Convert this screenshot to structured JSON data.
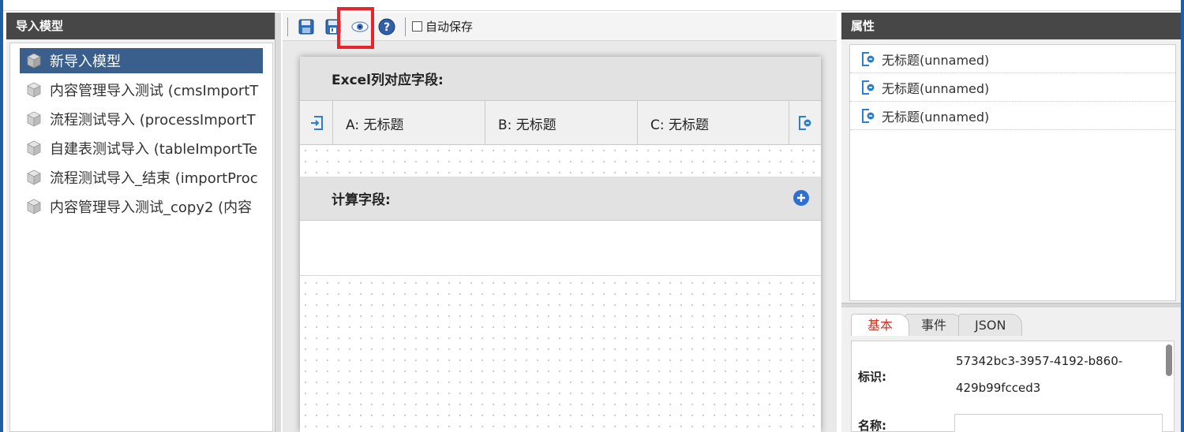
{
  "left_panel": {
    "title": "导入模型",
    "items": [
      {
        "label": "新导入模型"
      },
      {
        "label": "内容管理导入测试 (cmsImportT"
      },
      {
        "label": "流程测试导入 (processImportT"
      },
      {
        "label": "自建表测试导入 (tableImportTe"
      },
      {
        "label": "流程测试导入_结束 (importProc"
      },
      {
        "label": "内容管理导入测试_copy2 (内容"
      }
    ]
  },
  "toolbar": {
    "autosave_label": "自动保存"
  },
  "designer": {
    "excel_section_title": "Excel列对应字段:",
    "columns": [
      {
        "label": "A: 无标题"
      },
      {
        "label": "B: 无标题"
      },
      {
        "label": "C: 无标题"
      }
    ],
    "computed_section_title": "计算字段:"
  },
  "right_panel": {
    "title": "属性",
    "items": [
      {
        "label": "无标题(unnamed)"
      },
      {
        "label": "无标题(unnamed)"
      },
      {
        "label": "无标题(unnamed)"
      }
    ],
    "tabs": [
      {
        "label": "基本"
      },
      {
        "label": "事件"
      },
      {
        "label": "JSON"
      }
    ],
    "form": {
      "id_label": "标识:",
      "id_value_line1": "57342bc3-3957-4192-b860-",
      "id_value_line2": "429b99fcced3",
      "name_label": "名称:",
      "name_value": ""
    }
  },
  "colors": {
    "header_bg": "#474747",
    "selected_bg": "#3a5f8c",
    "highlight": "#e8232a",
    "active_tab_text": "#c0392b"
  }
}
